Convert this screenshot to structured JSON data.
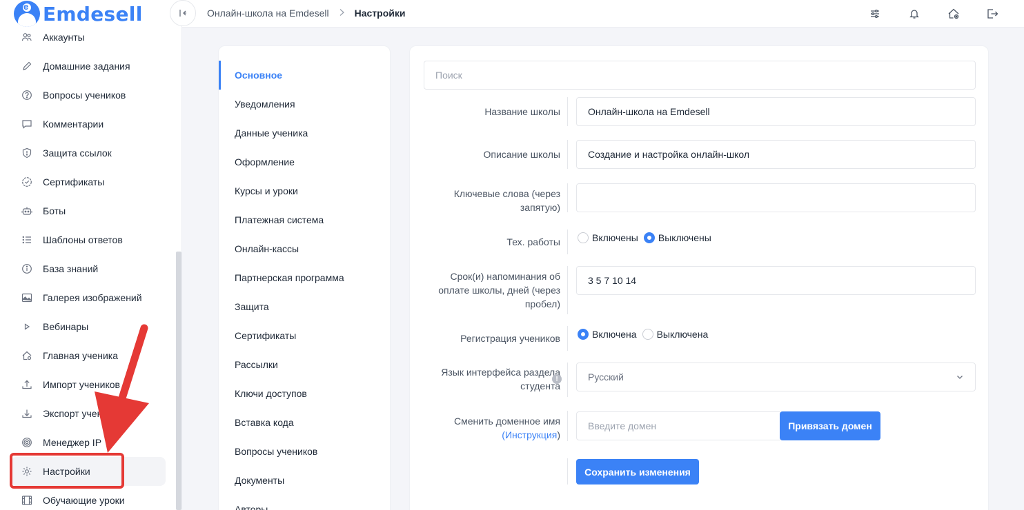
{
  "brand": {
    "name": "Emdesell",
    "mark_letter": "e",
    "color": "#3b82f6"
  },
  "sidebar": {
    "items": [
      {
        "label": "Аккаунты",
        "icon": "users-icon"
      },
      {
        "label": "Домашние задания",
        "icon": "pencil-icon"
      },
      {
        "label": "Вопросы учеников",
        "icon": "question-circle-icon"
      },
      {
        "label": "Комментарии",
        "icon": "comment-icon"
      },
      {
        "label": "Защита ссылок",
        "icon": "shield-icon"
      },
      {
        "label": "Сертификаты",
        "icon": "certificate-icon"
      },
      {
        "label": "Боты",
        "icon": "robot-icon"
      },
      {
        "label": "Шаблоны ответов",
        "icon": "list-icon"
      },
      {
        "label": "База знаний",
        "icon": "info-circle-icon"
      },
      {
        "label": "Галерея изображений",
        "icon": "image-icon"
      },
      {
        "label": "Вебинары",
        "icon": "play-icon"
      },
      {
        "label": "Главная ученика",
        "icon": "home-gear-icon"
      },
      {
        "label": "Импорт учеников",
        "icon": "upload-icon"
      },
      {
        "label": "Экспорт учеников",
        "icon": "download-icon"
      },
      {
        "label": "Менеджер IP",
        "icon": "target-icon"
      },
      {
        "label": "Настройки",
        "icon": "gear-icon",
        "active": true
      },
      {
        "label": "Обучающие уроки",
        "icon": "film-icon"
      }
    ]
  },
  "header": {
    "breadcrumb": {
      "parent": "Онлайн-школа на Emdesell",
      "current": "Настройки"
    },
    "icons": [
      "sliders-icon",
      "bell-icon",
      "home-settings-icon",
      "logout-icon"
    ]
  },
  "settings_menu": {
    "items": [
      "Основное",
      "Уведомления",
      "Данные ученика",
      "Оформление",
      "Курсы и уроки",
      "Платежная система",
      "Онлайн-кассы",
      "Партнерская программа",
      "Защита",
      "Сертификаты",
      "Рассылки",
      "Ключи доступов",
      "Вставка кода",
      "Вопросы учеников",
      "Документы",
      "Авторы"
    ],
    "active_index": 0
  },
  "form": {
    "search_placeholder": "Поиск",
    "school_name": {
      "label": "Название школы",
      "value": "Онлайн-школа на Emdesell"
    },
    "school_description": {
      "label": "Описание школы",
      "value": "Создание и настройка онлайн-школ"
    },
    "keywords": {
      "label_line1": "Ключевые слова (через",
      "label_line2": "запятую)",
      "value": ""
    },
    "maintenance": {
      "label": "Тех. работы",
      "option_on": "Включены",
      "option_off": "Выключены",
      "selected": "off"
    },
    "reminder": {
      "label_line1": "Срок(и) напоминания об",
      "label_line2": "оплате школы, дней (через",
      "label_line3": "пробел)",
      "value": "3 5 7 10 14"
    },
    "registration": {
      "label": "Регистрация учеников",
      "option_on": "Включена",
      "option_off": "Выключена",
      "selected": "on"
    },
    "language": {
      "label_line1": "Язык интерфейса раздела",
      "label_line2": "студента",
      "value": "Русский",
      "info": "!"
    },
    "domain": {
      "label_line1": "Сменить доменное имя",
      "label_open": "(",
      "link": "Инструкция",
      "label_close": ")",
      "placeholder": "Введите домен",
      "bind_button": "Привязать домен"
    },
    "save_button": "Сохранить изменения"
  },
  "colors": {
    "accent": "#3b82f6",
    "annotation": "#e53935"
  }
}
